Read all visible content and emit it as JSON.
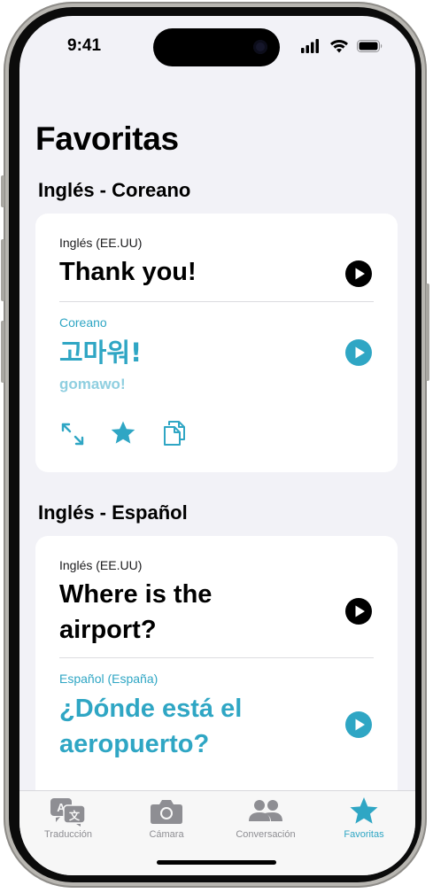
{
  "status": {
    "time": "9:41"
  },
  "page": {
    "title": "Favoritas"
  },
  "favorites": [
    {
      "pair": "Inglés - Coreano",
      "source_lang": "Inglés (EE.UU)",
      "source_text": "Thank you!",
      "target_lang": "Coreano",
      "target_text": "고마워!",
      "romanization": "gomawo!"
    },
    {
      "pair": "Inglés - Español",
      "source_lang": "Inglés (EE.UU)",
      "source_text_l1": "Where is the",
      "source_text_l2": "airport?",
      "target_lang": "Español (España)",
      "target_text_l1": "¿Dónde está el",
      "target_text_l2": "aeropuerto?"
    }
  ],
  "tabs": [
    {
      "label": "Traducción",
      "icon": "translate-icon"
    },
    {
      "label": "Cámara",
      "icon": "camera-icon"
    },
    {
      "label": "Conversación",
      "icon": "people-icon"
    },
    {
      "label": "Favoritas",
      "icon": "star-icon",
      "active": true
    }
  ],
  "colors": {
    "accent": "#2fa6c4",
    "background": "#f2f2f7"
  }
}
